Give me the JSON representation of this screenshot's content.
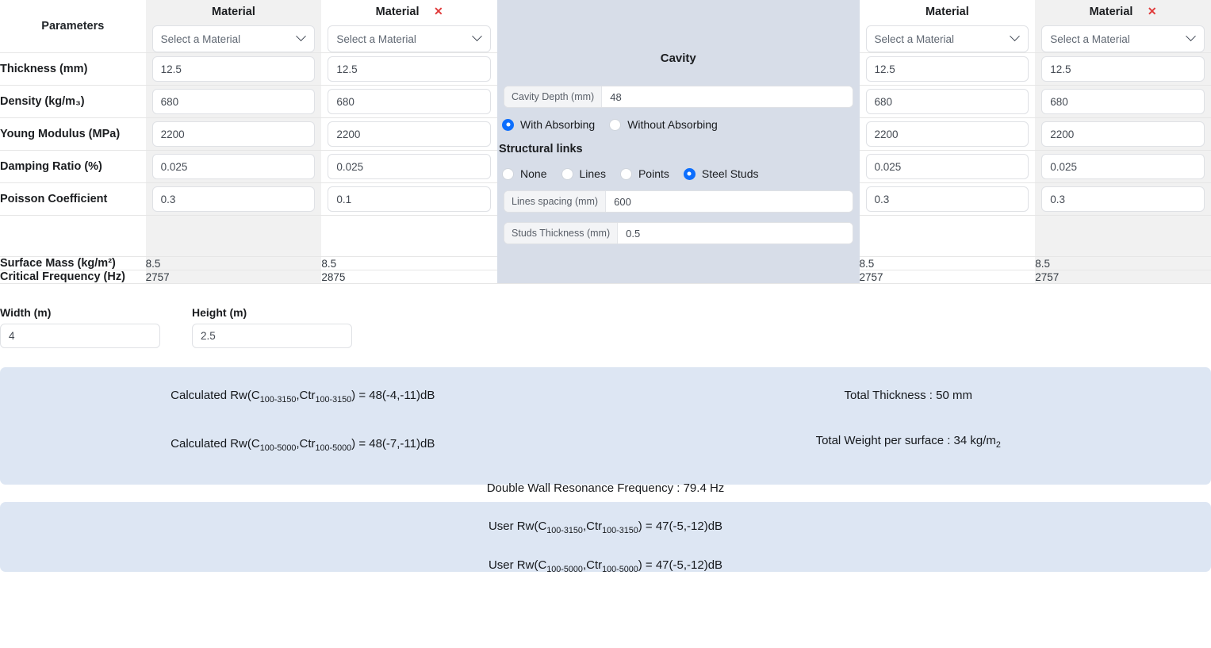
{
  "table": {
    "parameters_header": "Parameters",
    "rows": [
      {
        "label": "Thickness (mm)"
      },
      {
        "label": "Density (kg/m₃)"
      },
      {
        "label": "Young Modulus (MPa)"
      },
      {
        "label": "Damping Ratio (%)"
      },
      {
        "label": "Poisson Coefficient"
      }
    ],
    "computed_rows": [
      {
        "label": "Surface Mass (kg/m²)"
      },
      {
        "label": "Critical Frequency (Hz)"
      }
    ],
    "materials": [
      {
        "title": "Material",
        "closable": false,
        "close_label": "✕",
        "select_value": "Select a Material",
        "shaded": true,
        "thickness": "12.5",
        "density": "680",
        "young_modulus": "2200",
        "damping_ratio": "0.025",
        "poisson": "0.3",
        "surface_mass": "8.5",
        "critical_frequency": "2757"
      },
      {
        "title": "Material",
        "closable": true,
        "close_label": "✕",
        "select_value": "Select a Material",
        "shaded": false,
        "thickness": "12.5",
        "density": "680",
        "young_modulus": "2200",
        "damping_ratio": "0.025",
        "poisson": "0.1",
        "surface_mass": "8.5",
        "critical_frequency": "2875"
      },
      {
        "title": "Material",
        "closable": false,
        "close_label": "✕",
        "select_value": "Select a Material",
        "shaded": false,
        "thickness": "12.5",
        "density": "680",
        "young_modulus": "2200",
        "damping_ratio": "0.025",
        "poisson": "0.3",
        "surface_mass": "8.5",
        "critical_frequency": "2757"
      },
      {
        "title": "Material",
        "closable": true,
        "close_label": "✕",
        "select_value": "Select a Material",
        "shaded": true,
        "thickness": "12.5",
        "density": "680",
        "young_modulus": "2200",
        "damping_ratio": "0.025",
        "poisson": "0.3",
        "surface_mass": "8.5",
        "critical_frequency": "2757"
      }
    ]
  },
  "cavity": {
    "title": "Cavity",
    "depth_label": "Cavity Depth (mm)",
    "depth_value": "48",
    "absorbing": {
      "with_label": "With Absorbing",
      "without_label": "Without Absorbing",
      "selected": "with"
    },
    "structural_links_title": "Structural links",
    "links": {
      "none_label": "None",
      "lines_label": "Lines",
      "points_label": "Points",
      "steel_studs_label": "Steel Studs",
      "selected": "steel_studs"
    },
    "lines_spacing_label": "Lines spacing (mm)",
    "lines_spacing_value": "600",
    "studs_thickness_label": "Studs Thickness (mm)",
    "studs_thickness_value": "0.5"
  },
  "dimensions": {
    "width_label": "Width (m)",
    "width_value": "4",
    "height_label": "Height (m)",
    "height_value": "2.5"
  },
  "results": {
    "calculated_rw_3150_prefix": "Calculated Rw(C",
    "calculated_rw_3150_sub1": "100-3150",
    "calculated_rw_3150_mid": ",Ctr",
    "calculated_rw_3150_sub2": "100-3150",
    "calculated_rw_3150_suffix": ") = 48(-4,-11)dB",
    "calculated_rw_5000_prefix": "Calculated Rw(C",
    "calculated_rw_5000_sub1": "100-5000",
    "calculated_rw_5000_mid": ",Ctr",
    "calculated_rw_5000_sub2": "100-5000",
    "calculated_rw_5000_suffix": ") = 48(-7,-11)dB",
    "total_thickness": "Total Thickness : 50 mm",
    "total_weight_prefix": "Total Weight per surface : 34 kg/m",
    "total_weight_sub": "2",
    "double_wall_resonance": "Double Wall Resonance Frequency : 79.4 Hz",
    "user_rw_3150_prefix": "User Rw(C",
    "user_rw_3150_sub1": "100-3150",
    "user_rw_3150_mid": ",Ctr",
    "user_rw_3150_sub2": "100-3150",
    "user_rw_3150_suffix": ") = 47(-5,-12)dB",
    "user_rw_5000_prefix": "User Rw(C",
    "user_rw_5000_sub1": "100-5000",
    "user_rw_5000_mid": ",Ctr",
    "user_rw_5000_sub2": "100-5000",
    "user_rw_5000_suffix": ") = 47(-5,-12)dB"
  },
  "colors": {
    "panel_bg": "#dde6f3",
    "cavity_bg": "#d7dde8",
    "radio_accent": "#0d6efd",
    "close_icon": "#e03b3b",
    "shaded_column": "#f1f1f1"
  }
}
